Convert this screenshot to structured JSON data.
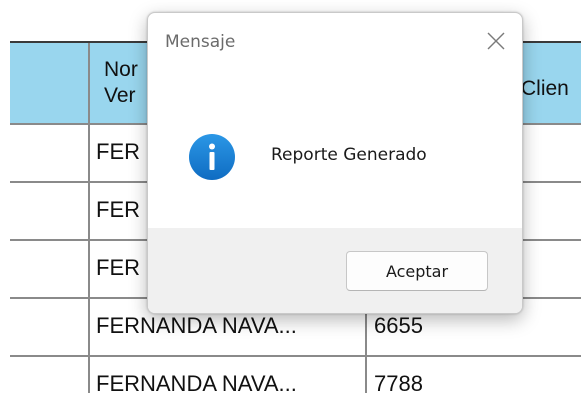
{
  "table": {
    "headers": {
      "col2": "Nombre Vendedor",
      "col3": "Cliente"
    },
    "header_lines": [
      "Nor",
      "Ver",
      "Clien"
    ],
    "rows": [
      {
        "name": "FER",
        "value": ""
      },
      {
        "name": "FER",
        "value": ""
      },
      {
        "name": "FER",
        "value": ""
      },
      {
        "name": "FERNANDA NAVA...",
        "value": "6655"
      },
      {
        "name": "FERNANDA NAVA...",
        "value": "7788"
      }
    ]
  },
  "dialog": {
    "title": "Mensaje",
    "message": "Reporte Generado",
    "ok_label": "Aceptar",
    "icon": "info-icon",
    "icon_color": "#1a7fd4"
  },
  "colors": {
    "header_bg": "#99d6ee",
    "grid_line": "#8a8a8a"
  }
}
